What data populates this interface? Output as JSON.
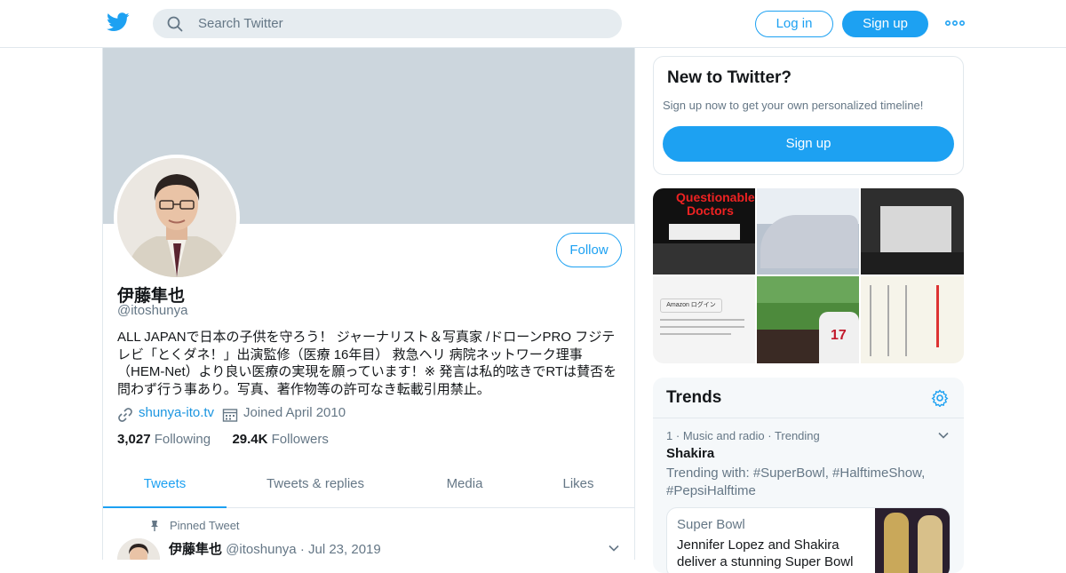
{
  "topbar": {
    "search_placeholder": "Search Twitter",
    "login_label": "Log in",
    "signup_label": "Sign up",
    "more_icon": "more-dots-icon",
    "brand_color": "#1DA1F2"
  },
  "profile": {
    "display_name": "伊藤隼也",
    "handle": "@itoshunya",
    "follow_label": "Follow",
    "bio_lines": [
      "ALL JAPANで日本の子供を守ろう！ ジャーナリスト＆写真家 /ドローンPRO フジテ",
      "レビ「とくダネ！」出演監修（医療 16年目） 救急ヘリ 病院ネットワーク理事",
      "（HEM-Net）より良い医療の実現を願っています！※ 発言は私的呟きでRTは賛否を",
      "問わず行う事あり。写真、著作物等の許可なき転載引用禁止。"
    ],
    "website": "shunya-ito.tv",
    "joined": "Joined April 2010",
    "following_count": "3,027",
    "following_label": "Following",
    "followers_count": "29.4K",
    "followers_label": "Followers"
  },
  "tabs": [
    "Tweets",
    "Tweets & replies",
    "Media",
    "Likes"
  ],
  "pinned_tweet": {
    "label": "Pinned Tweet",
    "name": "伊藤隼也",
    "handle": "@itoshunya",
    "date": "Jul 23, 2019"
  },
  "sidebar": {
    "new_title": "New to Twitter?",
    "new_subtitle": "Sign up now to get your own personalized timeline!",
    "new_button": "Sign up",
    "media_texts": {
      "book_title_1": "Questionable",
      "book_title_2": "Doctors",
      "amazon_login": "Amazon ログイン",
      "jersey_number": "17"
    },
    "trends": {
      "title": "Trends",
      "item_rank": "1",
      "item_category": "Music and radio",
      "item_status": "Trending",
      "item_name": "Shakira",
      "item_with": "Trending with: #SuperBowl, #HalftimeShow, #PepsiHalftime",
      "news_category": "Super Bowl",
      "news_title": "Jennifer Lopez and Shakira deliver a stunning Super Bowl"
    }
  }
}
